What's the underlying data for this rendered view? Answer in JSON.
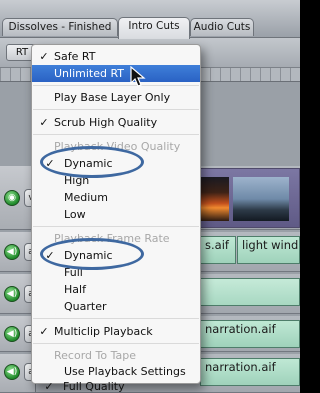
{
  "tabs": [
    {
      "label": "Dissolves - Finished"
    },
    {
      "label": "Intro Cuts"
    },
    {
      "label": "Audio Cuts"
    }
  ],
  "toolbar": {
    "rt_button": "RT"
  },
  "tracks": {
    "toggle_audio_glyph": "◀)",
    "patch_labels": [
      "v",
      "a",
      "a",
      "a",
      "a"
    ]
  },
  "clips": {
    "audio_right_1": "light wind.aif",
    "audio_mid_1": "s.aif",
    "audio_narration_1": "narration.aif",
    "audio_narration_2": "narration.aif"
  },
  "menu": {
    "items": [
      {
        "label": "Safe RT",
        "checked": true
      },
      {
        "label": "Unlimited RT",
        "checked": false,
        "highlighted": true
      },
      {
        "label": "Play Base Layer Only",
        "checked": false
      },
      {
        "label": "Scrub High Quality",
        "checked": true
      },
      {
        "label": "Playback Video Quality",
        "header": true
      },
      {
        "label": "Dynamic",
        "checked": true
      },
      {
        "label": "High"
      },
      {
        "label": "Medium"
      },
      {
        "label": "Low"
      },
      {
        "label": "Playback Frame Rate",
        "header": true
      },
      {
        "label": "Dynamic",
        "checked": true
      },
      {
        "label": "Full"
      },
      {
        "label": "Half"
      },
      {
        "label": "Quarter"
      },
      {
        "label": "Multiclip Playback",
        "checked": true
      },
      {
        "label": "Record To Tape",
        "header": true
      },
      {
        "label": "Use Playback Settings"
      },
      {
        "label": "Full Quality",
        "checked": true
      }
    ],
    "check_glyph": "✓"
  },
  "colors": {
    "highlight": "#2a62c4",
    "annotation_oval": "#3e68a0",
    "audio_clip": "#a8d8c2",
    "video_clip": "#6a658f"
  }
}
